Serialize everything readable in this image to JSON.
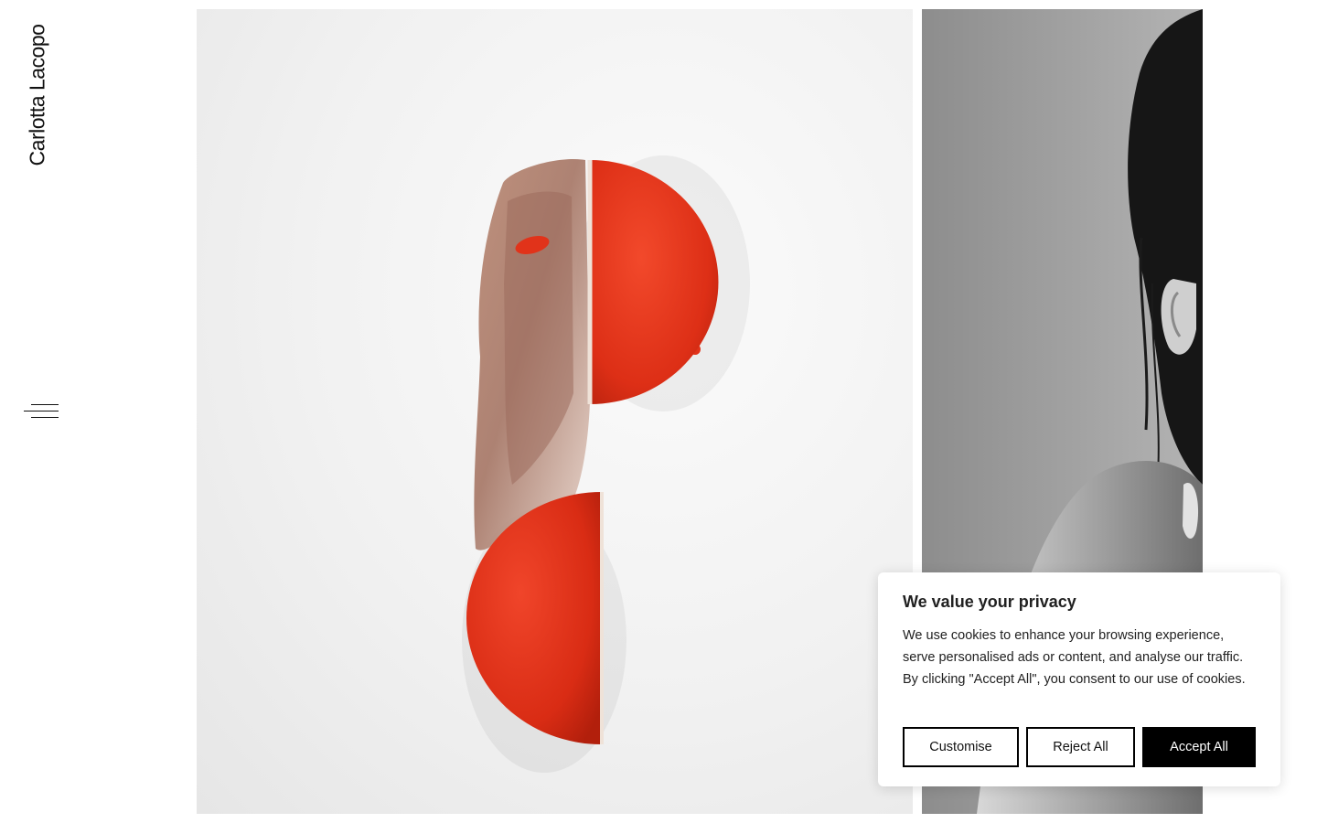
{
  "site": {
    "name": "Carlotta Lacopo"
  },
  "nav": {
    "menu_icon": "hamburger-menu-icon"
  },
  "gallery": {
    "images": [
      {
        "icon": "photo-red-dessert-hemispheres"
      },
      {
        "icon": "photo-black-white-portrait"
      }
    ]
  },
  "cookie_banner": {
    "title": "We value your privacy",
    "body": "We use cookies to enhance your browsing experience, serve personalised ads or content, and analyse our traffic. By clicking \"Accept All\", you consent to our use of cookies.",
    "buttons": {
      "customise": "Customise",
      "reject": "Reject All",
      "accept": "Accept All"
    }
  },
  "colors": {
    "accent": "#000000",
    "dessert_red": "#e3331c",
    "background": "#ffffff"
  }
}
